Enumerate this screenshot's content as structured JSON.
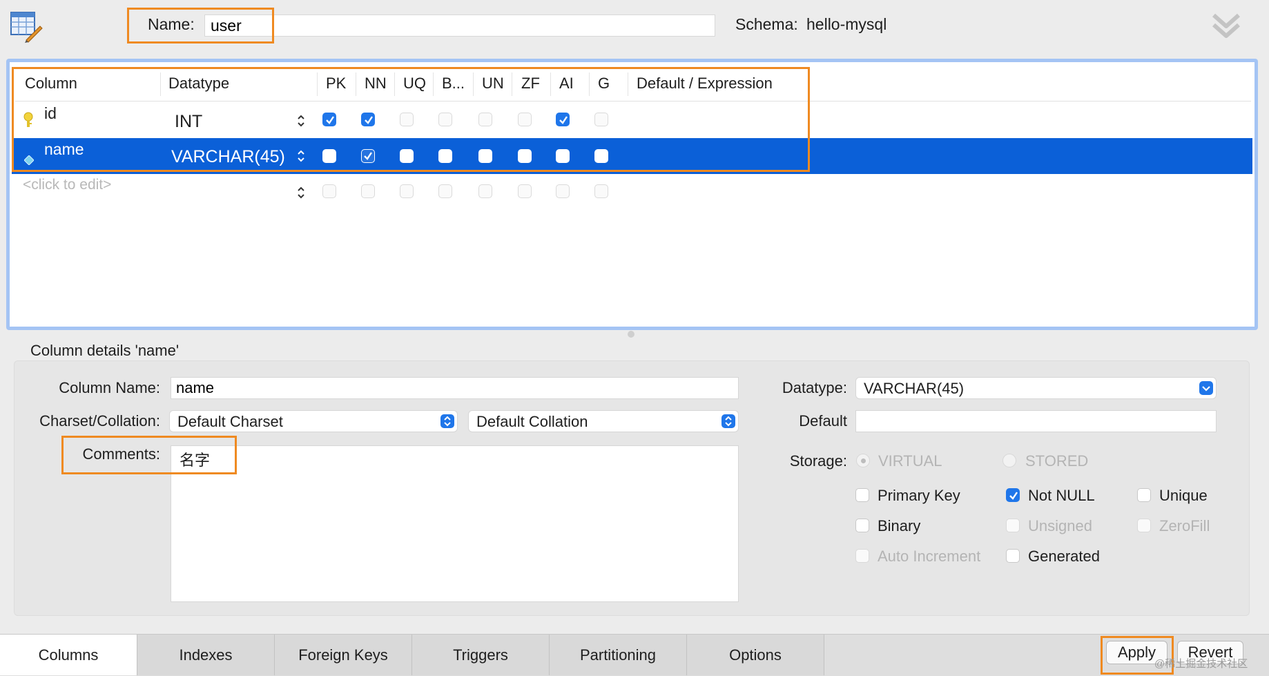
{
  "header": {
    "name_label": "Name:",
    "name_value": "user",
    "schema_label": "Schema:",
    "schema_value": "hello-mysql",
    "table_icon": "table-edit-icon",
    "collapse_icon": "double-chevron-down-icon"
  },
  "grid": {
    "columns": [
      "Column",
      "Datatype",
      "PK",
      "NN",
      "UQ",
      "B...",
      "UN",
      "ZF",
      "AI",
      "G",
      "Default / Expression"
    ],
    "rows": [
      {
        "name": "id",
        "datatype": "INT",
        "icon": "primary-key-icon",
        "flags": [
          true,
          true,
          false,
          false,
          false,
          false,
          true,
          false
        ],
        "selected": false
      },
      {
        "name": "name",
        "datatype": "VARCHAR(45)",
        "icon": "column-diamond-icon",
        "flags": [
          false,
          true,
          false,
          false,
          false,
          false,
          false,
          false
        ],
        "selected": true
      }
    ],
    "placeholder": "<click to edit>"
  },
  "details": {
    "title": "Column details 'name'",
    "column_name_label": "Column Name:",
    "column_name_value": "name",
    "charset_label": "Charset/Collation:",
    "charset_value": "Default Charset",
    "collation_value": "Default Collation",
    "comments_label": "Comments:",
    "comments_value": "名字",
    "datatype_label": "Datatype:",
    "datatype_value": "VARCHAR(45)",
    "default_label": "Default",
    "default_value": "",
    "storage_label": "Storage:",
    "storage_options": [
      "VIRTUAL",
      "STORED"
    ],
    "checkboxes": [
      {
        "label": "Primary Key",
        "checked": false,
        "disabled": false
      },
      {
        "label": "Not NULL",
        "checked": true,
        "disabled": false
      },
      {
        "label": "Unique",
        "checked": false,
        "disabled": false
      },
      {
        "label": "Binary",
        "checked": false,
        "disabled": false
      },
      {
        "label": "Unsigned",
        "checked": false,
        "disabled": true
      },
      {
        "label": "ZeroFill",
        "checked": false,
        "disabled": true
      },
      {
        "label": "Auto Increment",
        "checked": false,
        "disabled": true
      },
      {
        "label": "Generated",
        "checked": false,
        "disabled": false
      }
    ]
  },
  "tabs": [
    "Columns",
    "Indexes",
    "Foreign Keys",
    "Triggers",
    "Partitioning",
    "Options"
  ],
  "active_tab": "Columns",
  "buttons": {
    "apply": "Apply",
    "revert": "Revert"
  },
  "watermark": "@稀土掘金技术社区",
  "colors": {
    "accent": "#1f76ea",
    "highlight_row": "#0b60d8",
    "annotation": "#ef8a21",
    "grid_border": "#a4c4f4"
  }
}
